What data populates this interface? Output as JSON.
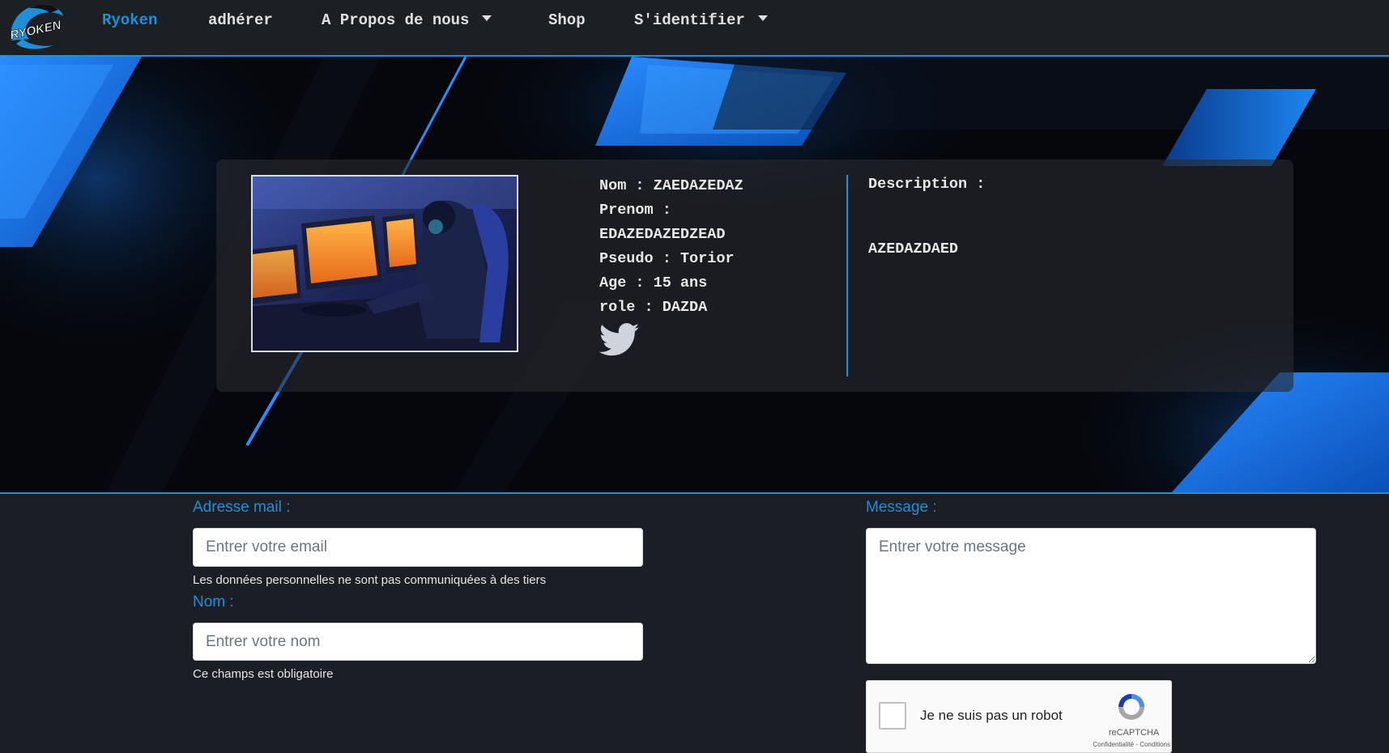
{
  "nav": {
    "brand_text": "RYOKEN",
    "items": [
      {
        "label": "Ryoken",
        "active": true
      },
      {
        "label": "adhérer"
      },
      {
        "label": "A Propos de nous",
        "dropdown": true
      },
      {
        "label": "Shop"
      },
      {
        "label": "S'identifier",
        "dropdown": true
      }
    ]
  },
  "profile": {
    "nom": "Nom : ZAEDAZEDAZ",
    "prenom_label": "Prenom :",
    "prenom_value": "EDAZEDAZEDZEAD",
    "pseudo": "Pseudo : Torior",
    "age": "Age : 15 ans",
    "role": "role : DAZDA",
    "social_icon": "twitter-icon",
    "description_title": "Description :",
    "description_text": "AZEDAZDAED"
  },
  "form": {
    "email_label": "Adresse mail :",
    "email_placeholder": "Entrer votre email",
    "email_help": "Les données personnelles ne sont pas communiquées à des tiers",
    "name_label": "Nom :",
    "name_placeholder": "Entrer votre nom",
    "name_help": "Ce champs est obligatoire",
    "message_label": "Message :",
    "message_placeholder": "Entrer votre message"
  },
  "recaptcha": {
    "label": "Je ne suis pas un robot",
    "brand": "reCAPTCHA",
    "terms": "Confidentialité - Conditions"
  },
  "colors": {
    "accent": "#1f8fd8",
    "navbar_bg": "#1c1f24",
    "page_bg": "#1b1e24"
  }
}
